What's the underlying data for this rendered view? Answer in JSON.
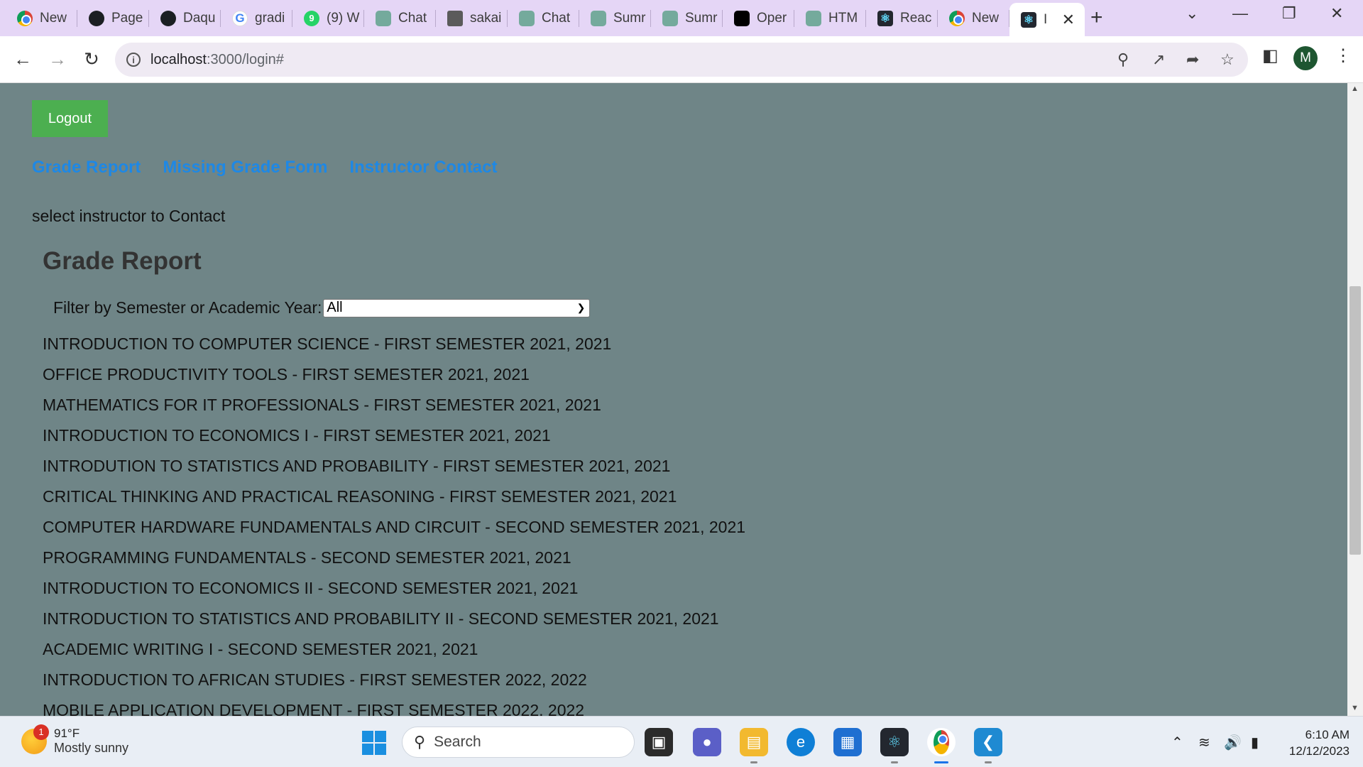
{
  "browser": {
    "tabs": [
      {
        "label": "New",
        "icon": "chrome-icon"
      },
      {
        "label": "Page",
        "icon": "github-icon"
      },
      {
        "label": "Daqu",
        "icon": "github-icon"
      },
      {
        "label": "gradi",
        "icon": "google-icon"
      },
      {
        "label": "(9) W",
        "icon": "whatsapp-icon"
      },
      {
        "label": "Chat",
        "icon": "chatgpt-icon"
      },
      {
        "label": "sakai",
        "icon": "sakai-icon"
      },
      {
        "label": "Chat",
        "icon": "chatgpt-icon"
      },
      {
        "label": "Sumr",
        "icon": "chatgpt-icon"
      },
      {
        "label": "Sumr",
        "icon": "chatgpt-icon"
      },
      {
        "label": "Oper",
        "icon": "openai-icon"
      },
      {
        "label": "HTM",
        "icon": "chatgpt-icon"
      },
      {
        "label": "Reac",
        "icon": "react-icon"
      },
      {
        "label": "New",
        "icon": "chrome-icon"
      },
      {
        "label": "I",
        "icon": "react-icon",
        "active": true
      }
    ],
    "new_tab_symbol": "+",
    "url_host": "localhost",
    "url_path": ":3000/login#",
    "profile_initial": "M"
  },
  "page": {
    "logout_label": "Logout",
    "nav": {
      "grade_report": "Grade Report",
      "missing_grade_form": "Missing Grade Form",
      "instructor_contact": "Instructor Contact"
    },
    "select_message": "select instructor to Contact",
    "report_title": "Grade Report",
    "filter_label": "Filter by Semester or Academic Year:",
    "filter_selected": "All",
    "courses": [
      "INTRODUCTION TO COMPUTER SCIENCE - FIRST SEMESTER 2021, 2021",
      "OFFICE PRODUCTIVITY TOOLS - FIRST SEMESTER 2021, 2021",
      "MATHEMATICS FOR IT PROFESSIONALS - FIRST SEMESTER 2021, 2021",
      "INTRODUCTION TO ECONOMICS I - FIRST SEMESTER 2021, 2021",
      "INTRODUTION TO STATISTICS AND PROBABILITY - FIRST SEMESTER 2021, 2021",
      "CRITICAL THINKING AND PRACTICAL REASONING - FIRST SEMESTER 2021, 2021",
      "COMPUTER HARDWARE FUNDAMENTALS AND CIRCUIT - SECOND SEMESTER 2021, 2021",
      "PROGRAMMING FUNDAMENTALS - SECOND SEMESTER 2021, 2021",
      "INTRODUCTION TO ECONOMICS II - SECOND SEMESTER 2021, 2021",
      "INTRODUCTION TO STATISTICS AND PROBABILITY II - SECOND SEMESTER 2021, 2021",
      "ACADEMIC WRITING I - SECOND SEMESTER 2021, 2021",
      "INTRODUCTION TO AFRICAN STUDIES - FIRST SEMESTER 2022, 2022",
      "MOBILE APPLICATION DEVELOPMENT - FIRST SEMESTER 2022, 2022"
    ]
  },
  "taskbar": {
    "weather_badge": "1",
    "temperature": "91°F",
    "condition": "Mostly sunny",
    "search_label": "Search",
    "time": "6:10 AM",
    "date": "12/12/2023"
  },
  "colors": {
    "page_bg": "#6f8587",
    "logout_bg": "#4caf50",
    "link": "#1e88e5",
    "tabstrip_bg": "#e5d6f6"
  }
}
